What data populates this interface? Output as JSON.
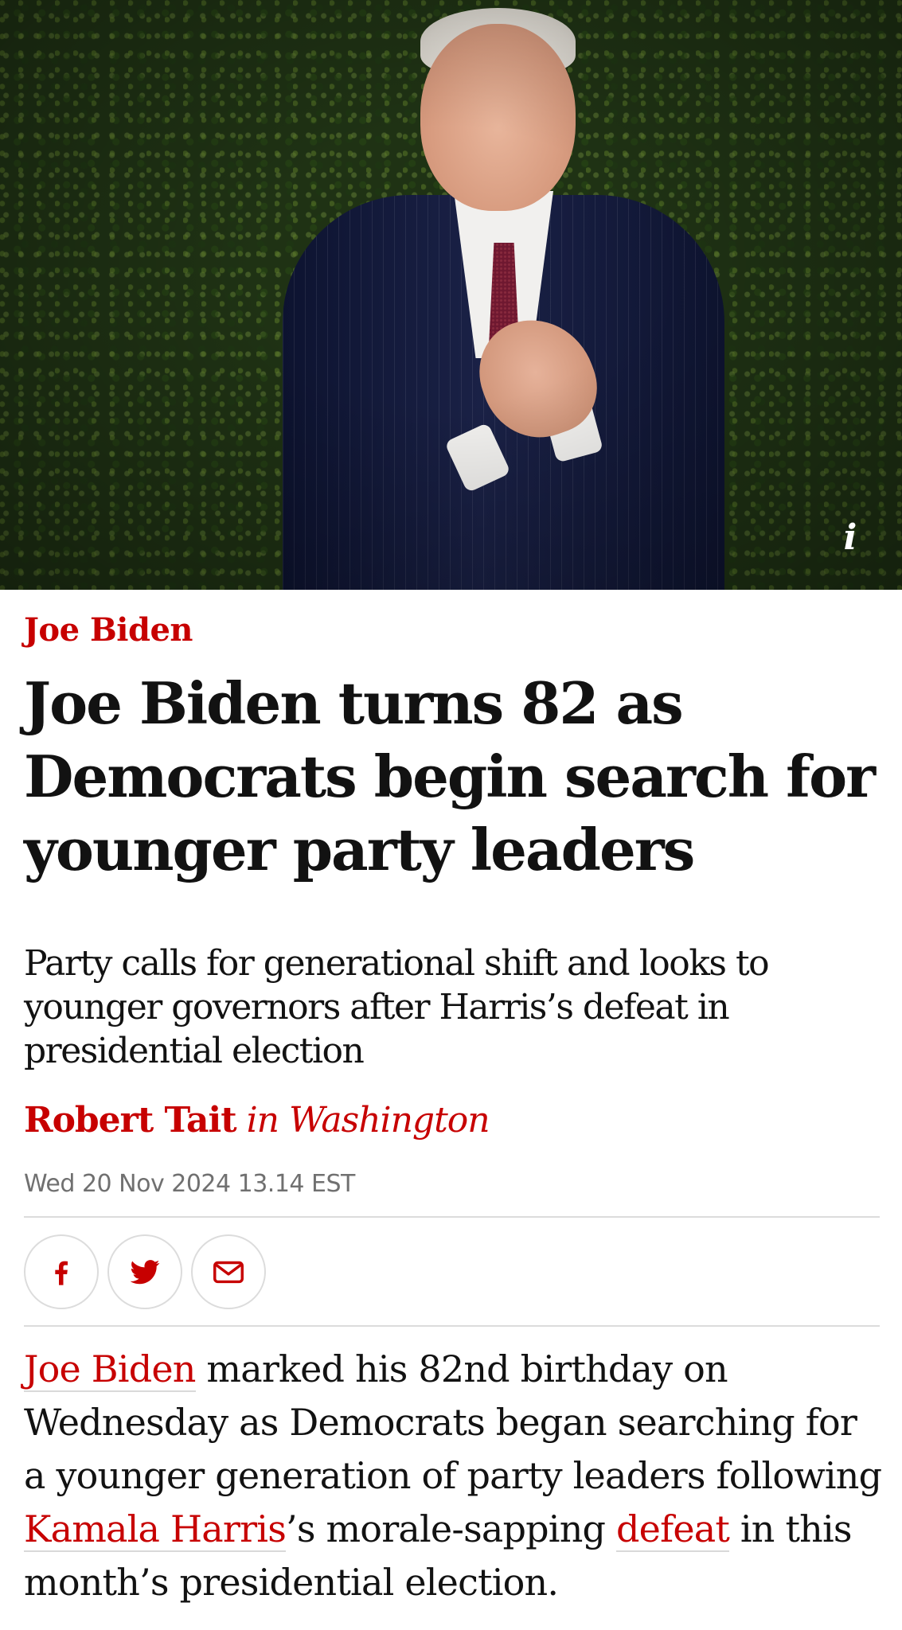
{
  "article": {
    "kicker": "Joe Biden",
    "headline": "Joe Biden turns 82 as Democrats begin search for younger party leaders",
    "standfirst": "Party calls for generational shift and looks to younger governors after Harris’s defeat in presidential election",
    "byline": {
      "author": "Robert Tait",
      "location": "in Washington"
    },
    "dateline": "Wed 20 Nov 2024 13.14 EST",
    "image_info_label": "i",
    "share": [
      {
        "icon": "facebook-icon"
      },
      {
        "icon": "twitter-icon"
      },
      {
        "icon": "email-icon"
      }
    ],
    "body": {
      "link_1": "Joe Biden",
      "text_1": " marked his 82nd birthday on Wednesday as Democrats began searching for a younger generation of party leaders following ",
      "link_2": "Kamala Harris",
      "text_2": "’s morale-sapping ",
      "link_3": "defeat",
      "text_3": " in this month’s presidential election."
    }
  },
  "colors": {
    "accent": "#c70000",
    "text": "#121212",
    "meta": "#707070",
    "rule": "#dcdcdc",
    "background": "#ffffff"
  }
}
